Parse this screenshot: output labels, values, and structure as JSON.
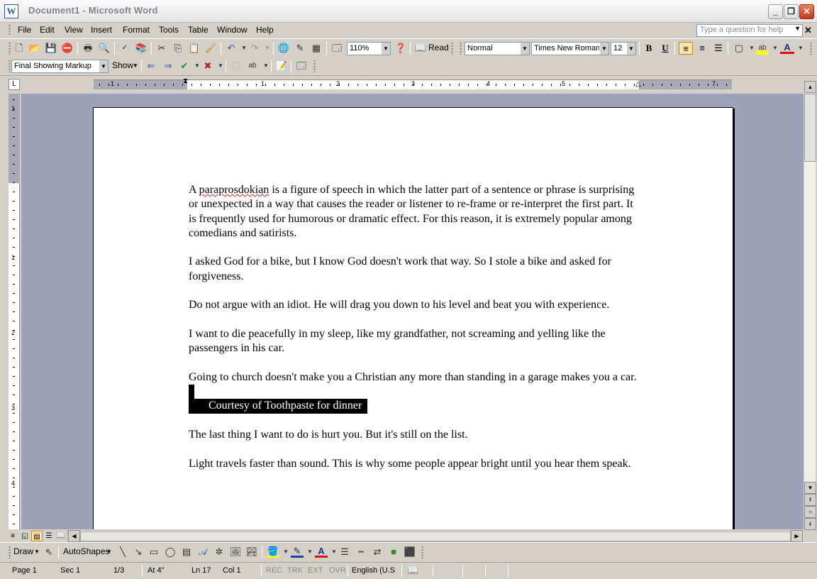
{
  "window": {
    "title": "Document1 - Microsoft Word",
    "app_icon": "W",
    "minimize": "_",
    "restore": "❐",
    "close": "✕"
  },
  "menubar": {
    "items": [
      {
        "label": "File"
      },
      {
        "label": "Edit"
      },
      {
        "label": "View"
      },
      {
        "label": "Insert"
      },
      {
        "label": "Format"
      },
      {
        "label": "Tools"
      },
      {
        "label": "Table"
      },
      {
        "label": "Window"
      },
      {
        "label": "Help"
      }
    ],
    "help_placeholder": "Type a question for help",
    "close_doc": "✕"
  },
  "standard_toolbar": {
    "zoom": "110%",
    "read_label": "Read"
  },
  "formatting_toolbar": {
    "style": "Normal",
    "font": "Times New Roman",
    "size": "12",
    "bold": "B",
    "underline": "U",
    "font_color_glyph": "A"
  },
  "reviewing_toolbar": {
    "markup": "Final Showing Markup",
    "show": "Show"
  },
  "ruler": {
    "horizontal_numbers": [
      "1",
      "1",
      "2",
      "3",
      "4",
      "5",
      "7"
    ],
    "vertical_numbers": [
      "1",
      "1",
      "2",
      "3",
      "4"
    ]
  },
  "document": {
    "paragraphs": [
      "is a figure of speech in which the latter part of a sentence or phrase is surprising or unexpected in a way that causes the reader or listener to re-frame or re-interpret the first part. It is frequently used for humorous or dramatic effect. For this reason, it is extremely popular among comedians and satirists.",
      "I asked God for a bike, but I know God doesn't work that way. So I stole a bike and asked for forgiveness.",
      "Do not argue with an idiot. He will drag you down to his level and beat you with experience.",
      "I want to die peacefully in my sleep, like my grandfather, not screaming and yelling like the passengers in his car.",
      "Going to church doesn't make you a Christian any more than standing in a garage makes you a car.",
      "The last thing I want to do is hurt you. But it's still on the list.",
      "Light travels faster than sound. This is why some people appear bright until you hear them speak."
    ],
    "first_word_prefix": "A",
    "misspelled_word": "paraprosdokian",
    "highlighted_line": "Courtesy of Toothpaste for dinner"
  },
  "drawing_toolbar": {
    "draw": "Draw",
    "autoshapes": "AutoShapes"
  },
  "statusbar": {
    "page": "Page  1",
    "sec": "Sec  1",
    "page_of": "1/3",
    "at": "At  4\"",
    "ln": "Ln  17",
    "col": "Col  1",
    "rec": "REC",
    "trk": "TRK",
    "ext": "EXT",
    "ovr": "OVR",
    "language": "English (U.S"
  }
}
